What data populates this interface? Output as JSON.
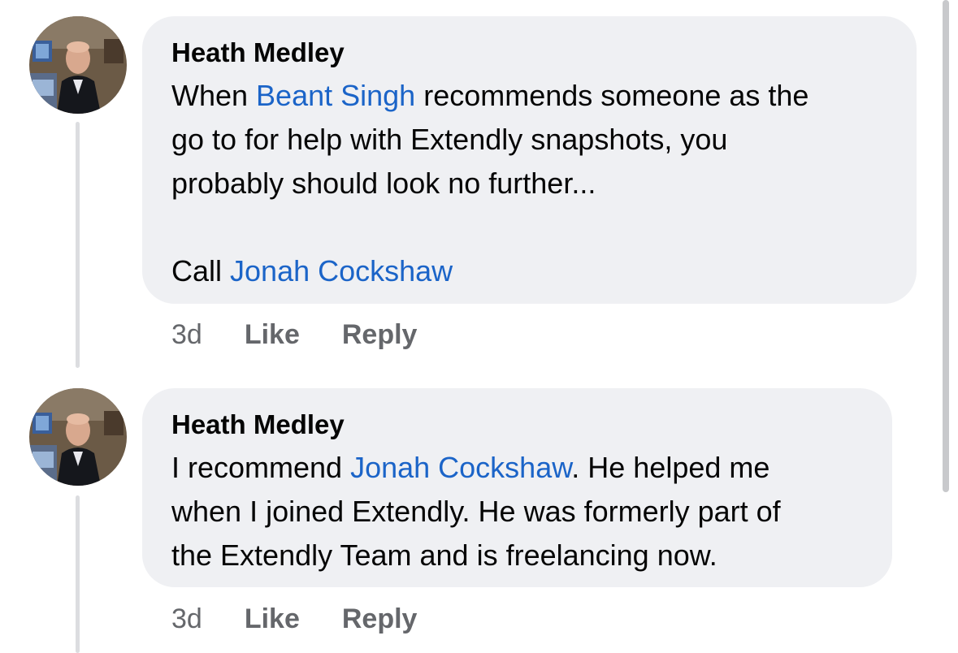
{
  "comments": [
    {
      "author": "Heath Medley",
      "lines": [
        [
          "When ",
          "Beant Singh",
          " recommends someone as the"
        ],
        [
          "go to for help with Extendly snapshots, you"
        ],
        [
          "probably should look no further..."
        ],
        [
          ""
        ],
        [
          "Call ",
          "Jonah Cockshaw",
          ""
        ]
      ],
      "time": "3d",
      "like_label": "Like",
      "reply_label": "Reply"
    },
    {
      "author": "Heath Medley",
      "lines": [
        [
          "I recommend ",
          "Jonah Cockshaw",
          ". He helped me"
        ],
        [
          "when I joined Extendly. He was formerly part of"
        ],
        [
          "the Extendly Team and is freelancing now."
        ]
      ],
      "time": "3d",
      "like_label": "Like",
      "reply_label": "Reply"
    }
  ],
  "colors": {
    "bubble": "#eff0f3",
    "link": "#1b64c8",
    "meta": "#65676b",
    "text": "#050505"
  }
}
